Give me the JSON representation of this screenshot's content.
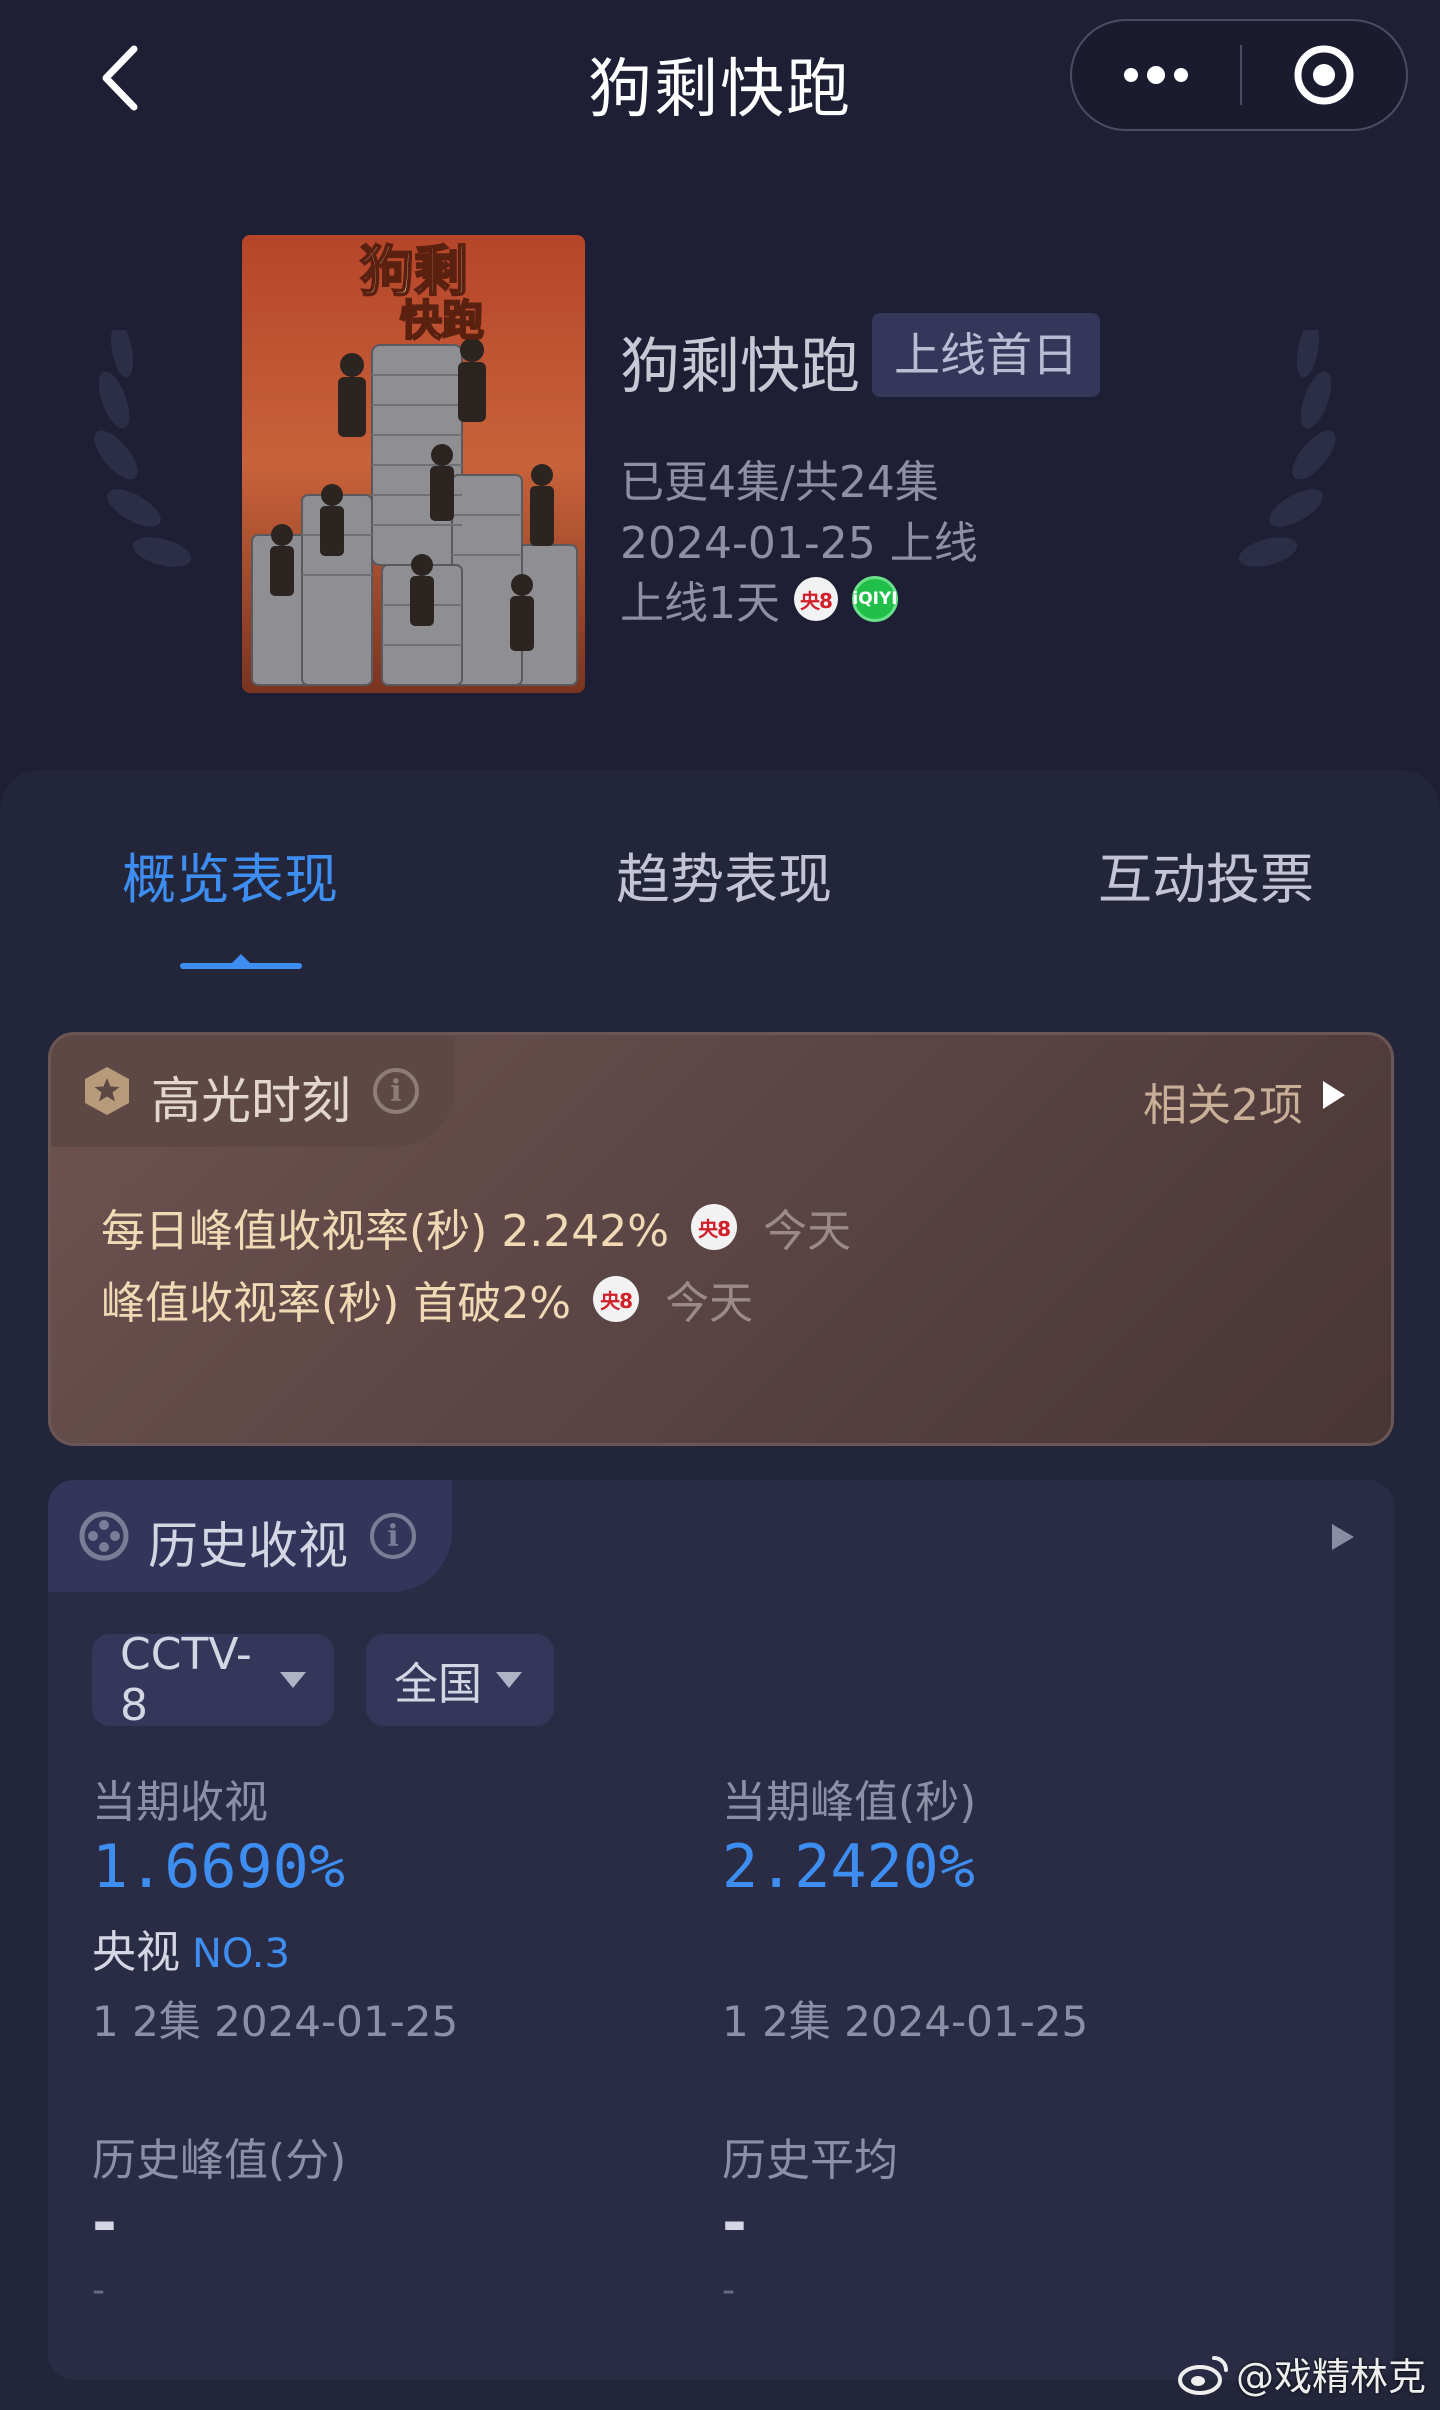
{
  "nav": {
    "title": "狗剩快跑",
    "back_icon": "chevron-left-icon",
    "more_icon": "more-dots-icon",
    "target_icon": "target-icon"
  },
  "show": {
    "poster_text_line1": "狗剩",
    "poster_text_line2": "快跑",
    "title": "狗剩快跑",
    "badge": "上线首日",
    "episodes": "已更4集/共24集",
    "release": "2024-01-25 上线",
    "online_days": "上线1天",
    "channel_badge": "央8",
    "platform_badge": "iQIYI"
  },
  "tabs": [
    "概览表现",
    "趋势表现",
    "互动投票"
  ],
  "highlight": {
    "title": "高光时刻",
    "related": "相关2项",
    "rows": [
      {
        "text": "每日峰值收视率(秒) 2.242%",
        "channel": "央8",
        "when": "今天"
      },
      {
        "text": "峰值收视率(秒) 首破2%",
        "channel": "央8",
        "when": "今天"
      }
    ]
  },
  "history": {
    "title": "历史收视",
    "channel_select": "CCTV-8",
    "region_select": "全国",
    "current_label": "当期收视",
    "current_value": "1.6690%",
    "rank_prefix": "央视",
    "rank_value": "NO.3",
    "current_sub": "1 2集 2024-01-25",
    "peak_label": "当期峰值(秒)",
    "peak_value": "2.2420%",
    "peak_sub": "1 2集 2024-01-25",
    "hist_peak_label": "历史峰值(分)",
    "hist_peak_value": "-",
    "hist_peak_sub": "-",
    "hist_avg_label": "历史平均",
    "hist_avg_value": "-",
    "hist_avg_sub": "-"
  },
  "watermark": "@戏精林克",
  "colors": {
    "background": "#1e1f35",
    "accent": "#3d8ef0",
    "highlight_text": "#f0d9b4"
  }
}
